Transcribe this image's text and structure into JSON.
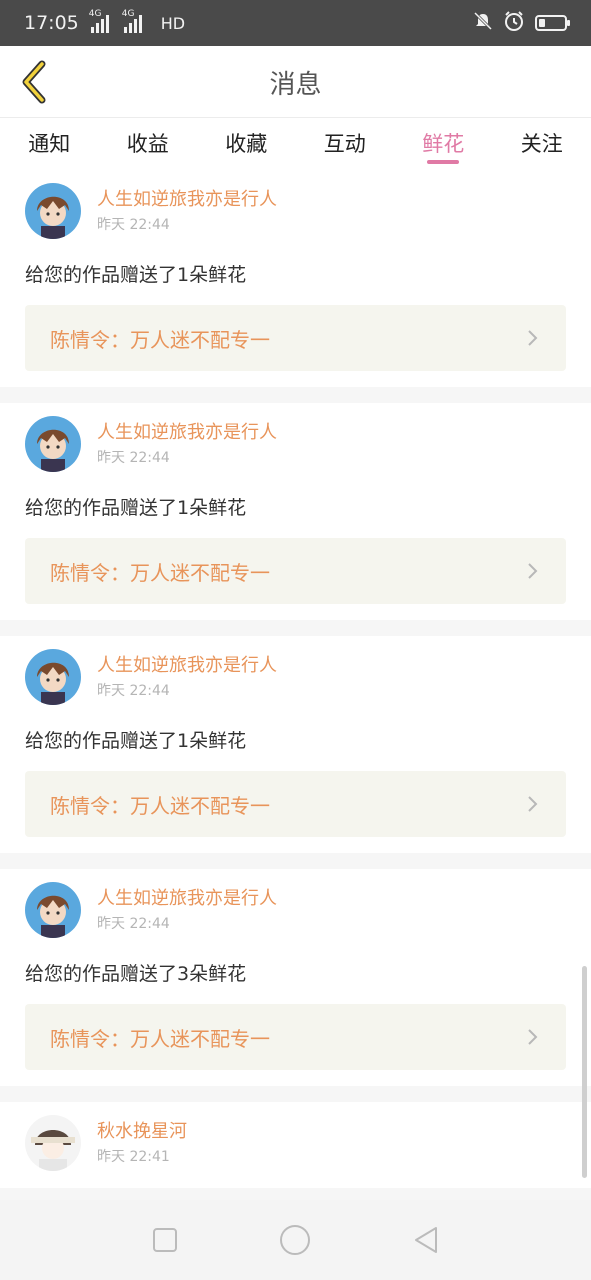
{
  "status_bar": {
    "time": "17:05",
    "net1": "4G",
    "net2": "4G",
    "hd": "HD",
    "battery_level": 0.25
  },
  "header": {
    "title": "消息"
  },
  "tabs": [
    {
      "label": "通知"
    },
    {
      "label": "收益"
    },
    {
      "label": "收藏"
    },
    {
      "label": "互动"
    },
    {
      "label": "鲜花",
      "active": true
    },
    {
      "label": "关注"
    }
  ],
  "feed": {
    "items": [
      {
        "user": "人生如逆旅我亦是行人",
        "time": "昨天 22:44",
        "message": "给您的作品赠送了1朵鲜花",
        "work": "陈情令：万人迷不配专一",
        "avatar_icon": "avatar-anime-boy"
      },
      {
        "user": "人生如逆旅我亦是行人",
        "time": "昨天 22:44",
        "message": "给您的作品赠送了1朵鲜花",
        "work": "陈情令：万人迷不配专一",
        "avatar_icon": "avatar-anime-boy"
      },
      {
        "user": "人生如逆旅我亦是行人",
        "time": "昨天 22:44",
        "message": "给您的作品赠送了1朵鲜花",
        "work": "陈情令：万人迷不配专一",
        "avatar_icon": "avatar-anime-boy"
      },
      {
        "user": "人生如逆旅我亦是行人",
        "time": "昨天 22:44",
        "message": "给您的作品赠送了3朵鲜花",
        "work": "陈情令：万人迷不配专一",
        "avatar_icon": "avatar-anime-boy"
      },
      {
        "user": "秋水挽星河",
        "time": "昨天 22:41",
        "avatar_icon": "avatar-anime-sketch"
      }
    ]
  },
  "colors": {
    "accent": "#e07aa5",
    "name": "#e8945a",
    "card_bg": "#f5f5ee"
  },
  "icons": {
    "back": "back-chevron-icon",
    "chevron": "chevron-right-icon",
    "nav": [
      "square-icon",
      "circle-icon",
      "triangle-back-icon"
    ]
  }
}
